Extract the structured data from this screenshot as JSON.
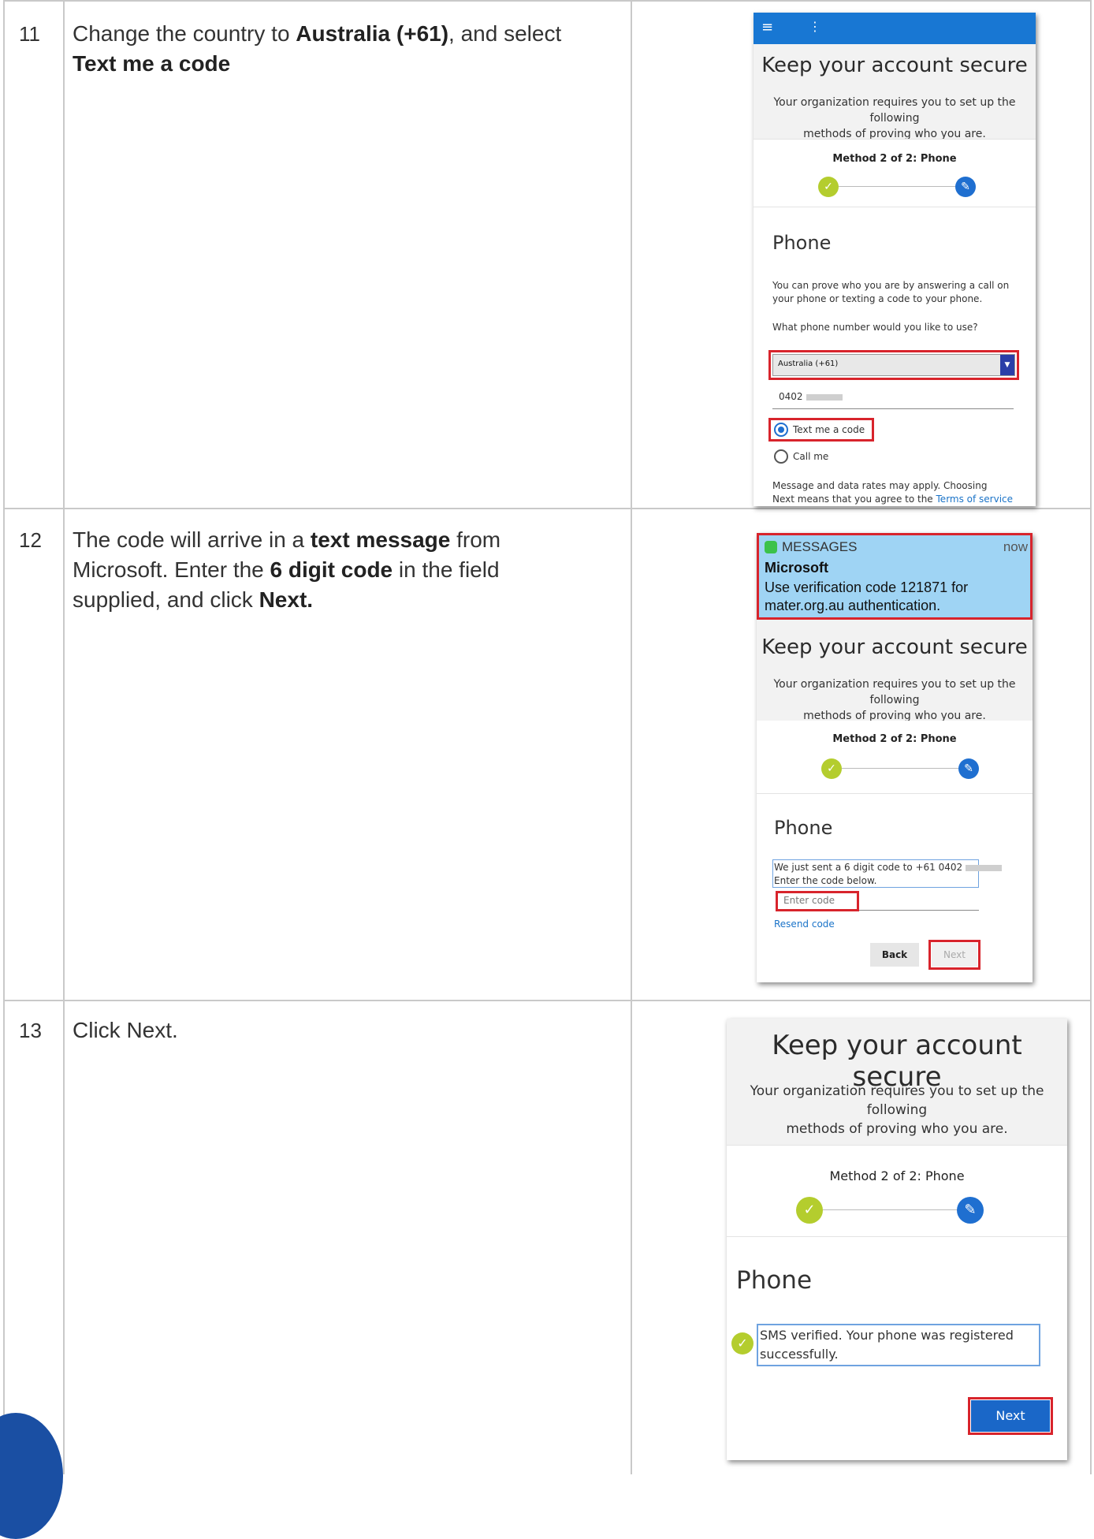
{
  "steps": [
    {
      "num": "11",
      "text_parts": [
        "Change the country to ",
        "Australia (+61)",
        ", and select ",
        "Text me a code"
      ],
      "screenshot": {
        "title": "Keep your account secure",
        "subtitle_line1": "Your organization requires you to set up the following",
        "subtitle_line2": "methods of proving who you are.",
        "method": "Method 2 of 2: Phone",
        "phone_heading": "Phone",
        "desc_line1": "You can prove who you are by answering a call on",
        "desc_line2": "your phone or texting a code to your phone.",
        "question": "What phone number would you like to use?",
        "country": "Australia (+61)",
        "phone_number": "0402",
        "option_text": "Text me a code",
        "option_call": "Call me",
        "footer_line1": "Message and data rates may apply. Choosing",
        "footer_line2_prefix": "Next means that you agree to the ",
        "footer_link": "Terms of service"
      }
    },
    {
      "num": "12",
      "text_parts": [
        "The code will arrive in a ",
        "text message",
        " from Microsoft.  Enter the ",
        "6 digit code",
        " in the field supplied, and click ",
        "Next."
      ],
      "screenshot": {
        "notif_app": "MESSAGES",
        "notif_time": "now",
        "notif_sender": "Microsoft",
        "notif_line1": "Use verification code 121871 for",
        "notif_line2": "mater.org.au authentication.",
        "title": "Keep your account secure",
        "subtitle_line1": "Your organization requires you to set up the following",
        "subtitle_line2": "methods of proving who you are.",
        "method": "Method 2 of 2: Phone",
        "phone_heading": "Phone",
        "sent_line1": "We just sent a 6 digit code to +61 0402",
        "sent_line2": "Enter the code below.",
        "code_placeholder": "Enter code",
        "resend": "Resend code",
        "back": "Back",
        "next": "Next"
      }
    },
    {
      "num": "13",
      "text": "Click Next.",
      "screenshot": {
        "title": "Keep your account secure",
        "subtitle_line1": "Your organization requires you to set up the following",
        "subtitle_line2": "methods of proving who you are.",
        "method": "Method 2 of 2: Phone",
        "phone_heading": "Phone",
        "verified_line1": "SMS verified. Your phone was registered",
        "verified_line2": "successfully.",
        "next": "Next"
      }
    }
  ]
}
